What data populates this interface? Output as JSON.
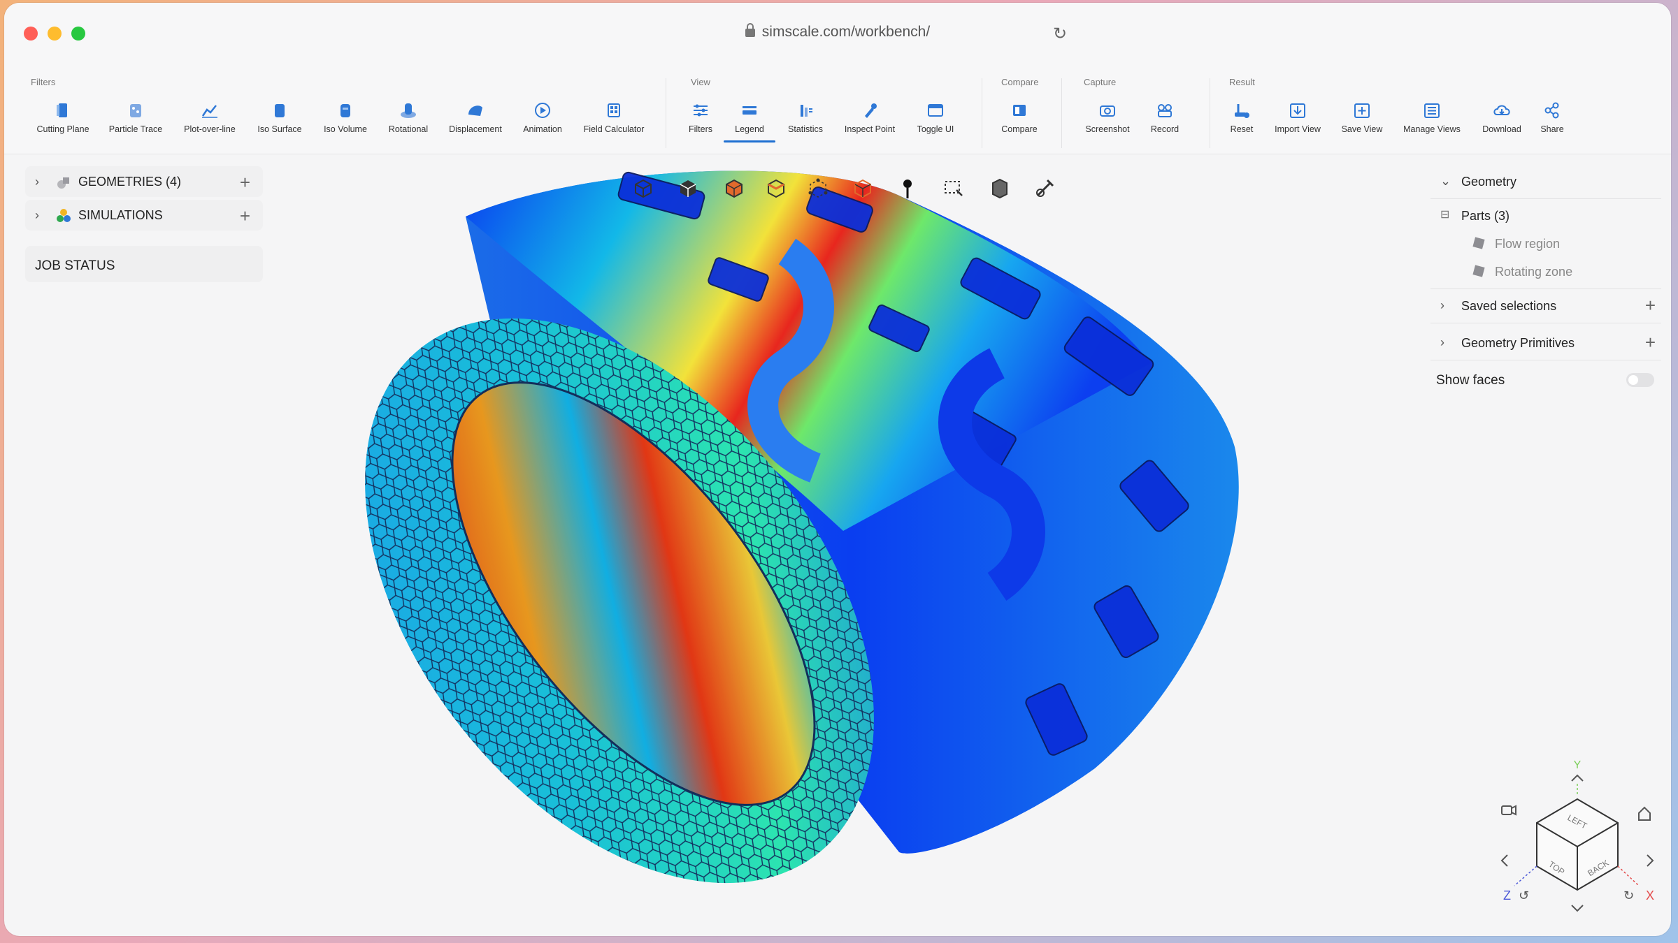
{
  "browser": {
    "url": "simscale.com/workbench/"
  },
  "toolbar": {
    "groups": [
      {
        "label": "Filters",
        "tools": [
          "Cutting Plane",
          "Particle Trace",
          "Plot-over-line",
          "Iso Surface",
          "Iso Volume",
          "Rotational",
          "Displacement",
          "Animation",
          "Field Calculator"
        ]
      },
      {
        "label": "View",
        "tools": [
          "Filters",
          "Legend",
          "Statistics",
          "Inspect Point",
          "Toggle UI"
        ]
      },
      {
        "label": "Compare",
        "tools": [
          "Compare"
        ]
      },
      {
        "label": "Capture",
        "tools": [
          "Screenshot",
          "Record"
        ]
      },
      {
        "label": "Result",
        "tools": [
          "Reset",
          "Import View",
          "Save View",
          "Manage Views",
          "Download",
          "Share"
        ]
      }
    ],
    "active_tool": "Legend"
  },
  "left_panel": {
    "items": [
      {
        "label": "GEOMETRIES (4)"
      },
      {
        "label": "SIMULATIONS"
      }
    ],
    "job_status": "JOB STATUS"
  },
  "right_panel": {
    "geometry": "Geometry",
    "parts": "Parts (3)",
    "part_items": [
      "Flow region",
      "Rotating zone"
    ],
    "saved_selections": "Saved selections",
    "geometry_primitives": "Geometry Primitives",
    "show_faces": "Show faces",
    "show_faces_enabled": false
  },
  "axes": {
    "y": "Y",
    "z": "Z",
    "x": "X"
  },
  "cube_faces": {
    "left": "LEFT",
    "top": "TOP",
    "back": "BACK"
  },
  "colors": {
    "accent": "#1f6fd1",
    "close": "#ff5f57",
    "minimize": "#febc2e",
    "maximize": "#28c840"
  }
}
